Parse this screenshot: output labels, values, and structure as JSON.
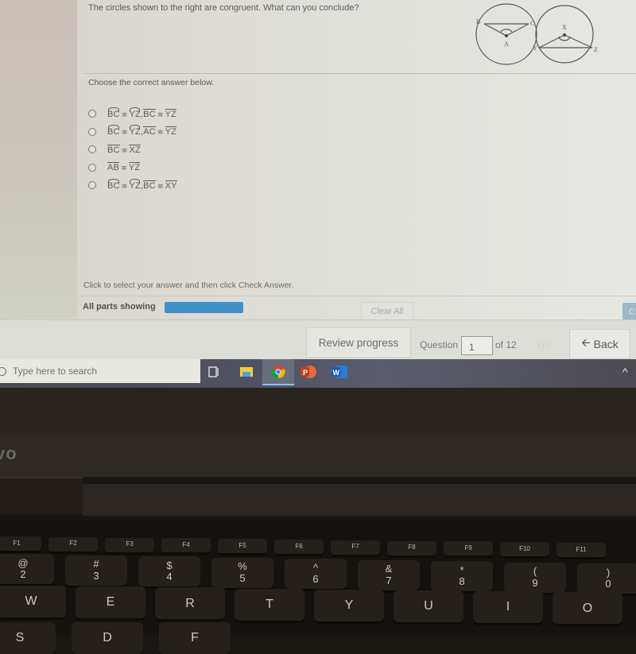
{
  "question": {
    "prompt": "The circles shown to the right are congruent. What can you conclude?",
    "figure": {
      "circle1_points": [
        "B",
        "C",
        "A"
      ],
      "circle2_points": [
        "X",
        "Y",
        "Z"
      ]
    },
    "choose_label": "Choose the correct answer below.",
    "options": [
      {
        "parts": [
          {
            "t": "BC",
            "mark": "arc"
          },
          {
            "t": "≅",
            "mark": "cong"
          },
          {
            "t": "YZ",
            "mark": "arc"
          },
          {
            "t": ", ",
            "mark": "none"
          },
          {
            "t": "BC",
            "mark": "bar"
          },
          {
            "t": "≅",
            "mark": "cong"
          },
          {
            "t": "YZ",
            "mark": "bar"
          }
        ]
      },
      {
        "parts": [
          {
            "t": "BC",
            "mark": "arc"
          },
          {
            "t": "≅",
            "mark": "cong"
          },
          {
            "t": "YZ",
            "mark": "arc"
          },
          {
            "t": ", ",
            "mark": "none"
          },
          {
            "t": "AC",
            "mark": "bar"
          },
          {
            "t": "≅",
            "mark": "cong"
          },
          {
            "t": "YZ",
            "mark": "bar"
          }
        ]
      },
      {
        "parts": [
          {
            "t": "BC",
            "mark": "bar"
          },
          {
            "t": "≅",
            "mark": "cong"
          },
          {
            "t": "XZ",
            "mark": "bar"
          }
        ]
      },
      {
        "parts": [
          {
            "t": "AB",
            "mark": "bar"
          },
          {
            "t": "≅",
            "mark": "cong"
          },
          {
            "t": "YZ",
            "mark": "bar"
          }
        ]
      },
      {
        "parts": [
          {
            "t": "BC",
            "mark": "arc"
          },
          {
            "t": "≅",
            "mark": "cong"
          },
          {
            "t": "YZ",
            "mark": "arc"
          },
          {
            "t": ", ",
            "mark": "none"
          },
          {
            "t": "BC",
            "mark": "bar"
          },
          {
            "t": "≅",
            "mark": "cong"
          },
          {
            "t": "XY",
            "mark": "bar"
          }
        ]
      }
    ],
    "instruction": "Click to select your answer and then click Check Answer.",
    "parts_label": "All parts showing",
    "progress_fraction": 1.0,
    "clear_all_label": "Clear All",
    "check_answer_label": "C"
  },
  "nav": {
    "review_progress_label": "Review progress",
    "question_label": "Question",
    "question_number": "1",
    "of_label": "of 12",
    "go_label": "Go",
    "back_label": "Back"
  },
  "taskbar": {
    "search_placeholder": "Type here to search",
    "apps": [
      {
        "name": "task-view",
        "glyph": "⧉"
      },
      {
        "name": "file-explorer",
        "glyph": "▬"
      },
      {
        "name": "chrome",
        "glyph": "●"
      },
      {
        "name": "powerpoint",
        "glyph": "P"
      },
      {
        "name": "word",
        "glyph": "W"
      }
    ],
    "tray_chevron": "^"
  },
  "laptop": {
    "brand": "vo",
    "fkeys": [
      "F1",
      "F2",
      "F3",
      "F4",
      "F5",
      "F6",
      "F7",
      "F8",
      "F9",
      "F10",
      "F11"
    ],
    "number_row": [
      {
        "top": "@",
        "main": "2"
      },
      {
        "top": "#",
        "main": "3"
      },
      {
        "top": "$",
        "main": "4"
      },
      {
        "top": "%",
        "main": "5"
      },
      {
        "top": "^",
        "main": "6"
      },
      {
        "top": "&",
        "main": "7"
      },
      {
        "top": "*",
        "main": "8"
      },
      {
        "top": "(",
        "main": "9"
      },
      {
        "top": ")",
        "main": "0"
      }
    ],
    "letter_row": [
      "W",
      "E",
      "R",
      "T",
      "Y",
      "U",
      "I",
      "O"
    ],
    "bottom_row": [
      "S",
      "D",
      "F"
    ]
  },
  "colors": {
    "progress": "#3f8fc9",
    "check_answer": "#9db8c9",
    "taskbar_accent": "#8bc3ef"
  }
}
